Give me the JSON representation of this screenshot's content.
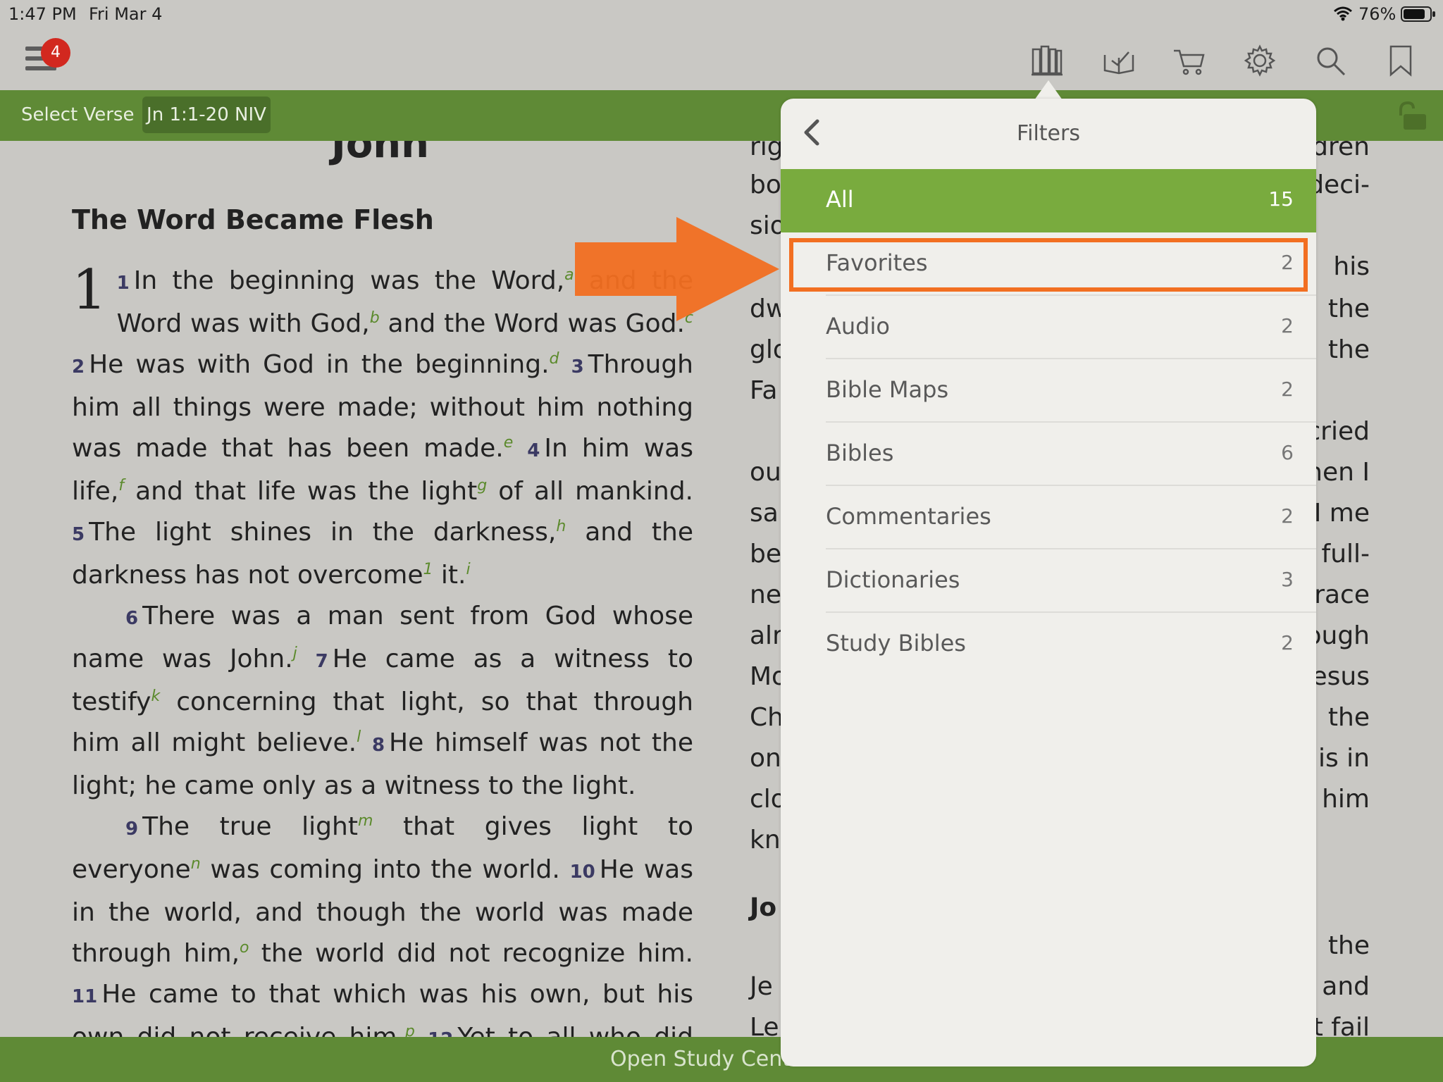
{
  "status_bar": {
    "time": "1:47 PM",
    "date": "Fri Mar 4",
    "battery": "76%"
  },
  "toolbar": {
    "menu_badge": "4"
  },
  "verse_bar": {
    "select_label": "Select Verse",
    "reference": "Jn 1:1-20 NIV"
  },
  "reader": {
    "book_title": "John",
    "section_heading": "The Word Became Flesh",
    "chapter": "1",
    "right_fragments": [
      "rig",
      "bo",
      "sio",
      "",
      "",
      "dw",
      "glo",
      "Fa",
      "",
      "ou",
      "sa",
      "be",
      "ne",
      "alr",
      "Mo",
      "Ch",
      "on",
      "clo",
      "kn",
      "",
      "Jo",
      "",
      "Je",
      "Le"
    ],
    "right_edge_fragments": [
      "dren",
      "deci-",
      "",
      "his",
      "the",
      "the",
      "",
      "cried",
      "hen I",
      "I me",
      "full-",
      "grace",
      "ough",
      "Jesus",
      "the",
      "is in",
      "him",
      "",
      "",
      "",
      "the",
      "and",
      "t fail"
    ]
  },
  "popover": {
    "title": "Filters",
    "items": [
      {
        "label": "All",
        "count": "15"
      },
      {
        "label": "Favorites",
        "count": "2"
      },
      {
        "label": "Audio",
        "count": "2"
      },
      {
        "label": "Bible Maps",
        "count": "2"
      },
      {
        "label": "Bibles",
        "count": "6"
      },
      {
        "label": "Commentaries",
        "count": "2"
      },
      {
        "label": "Dictionaries",
        "count": "3"
      },
      {
        "label": "Study Bibles",
        "count": "2"
      }
    ]
  },
  "bottom_bar": {
    "label": "Open Study Center"
  },
  "colors": {
    "accent_green": "#5f8a36",
    "selected_row": "#79ab3e",
    "annotation_orange": "#f26f21",
    "badge_red": "#d2281f"
  }
}
